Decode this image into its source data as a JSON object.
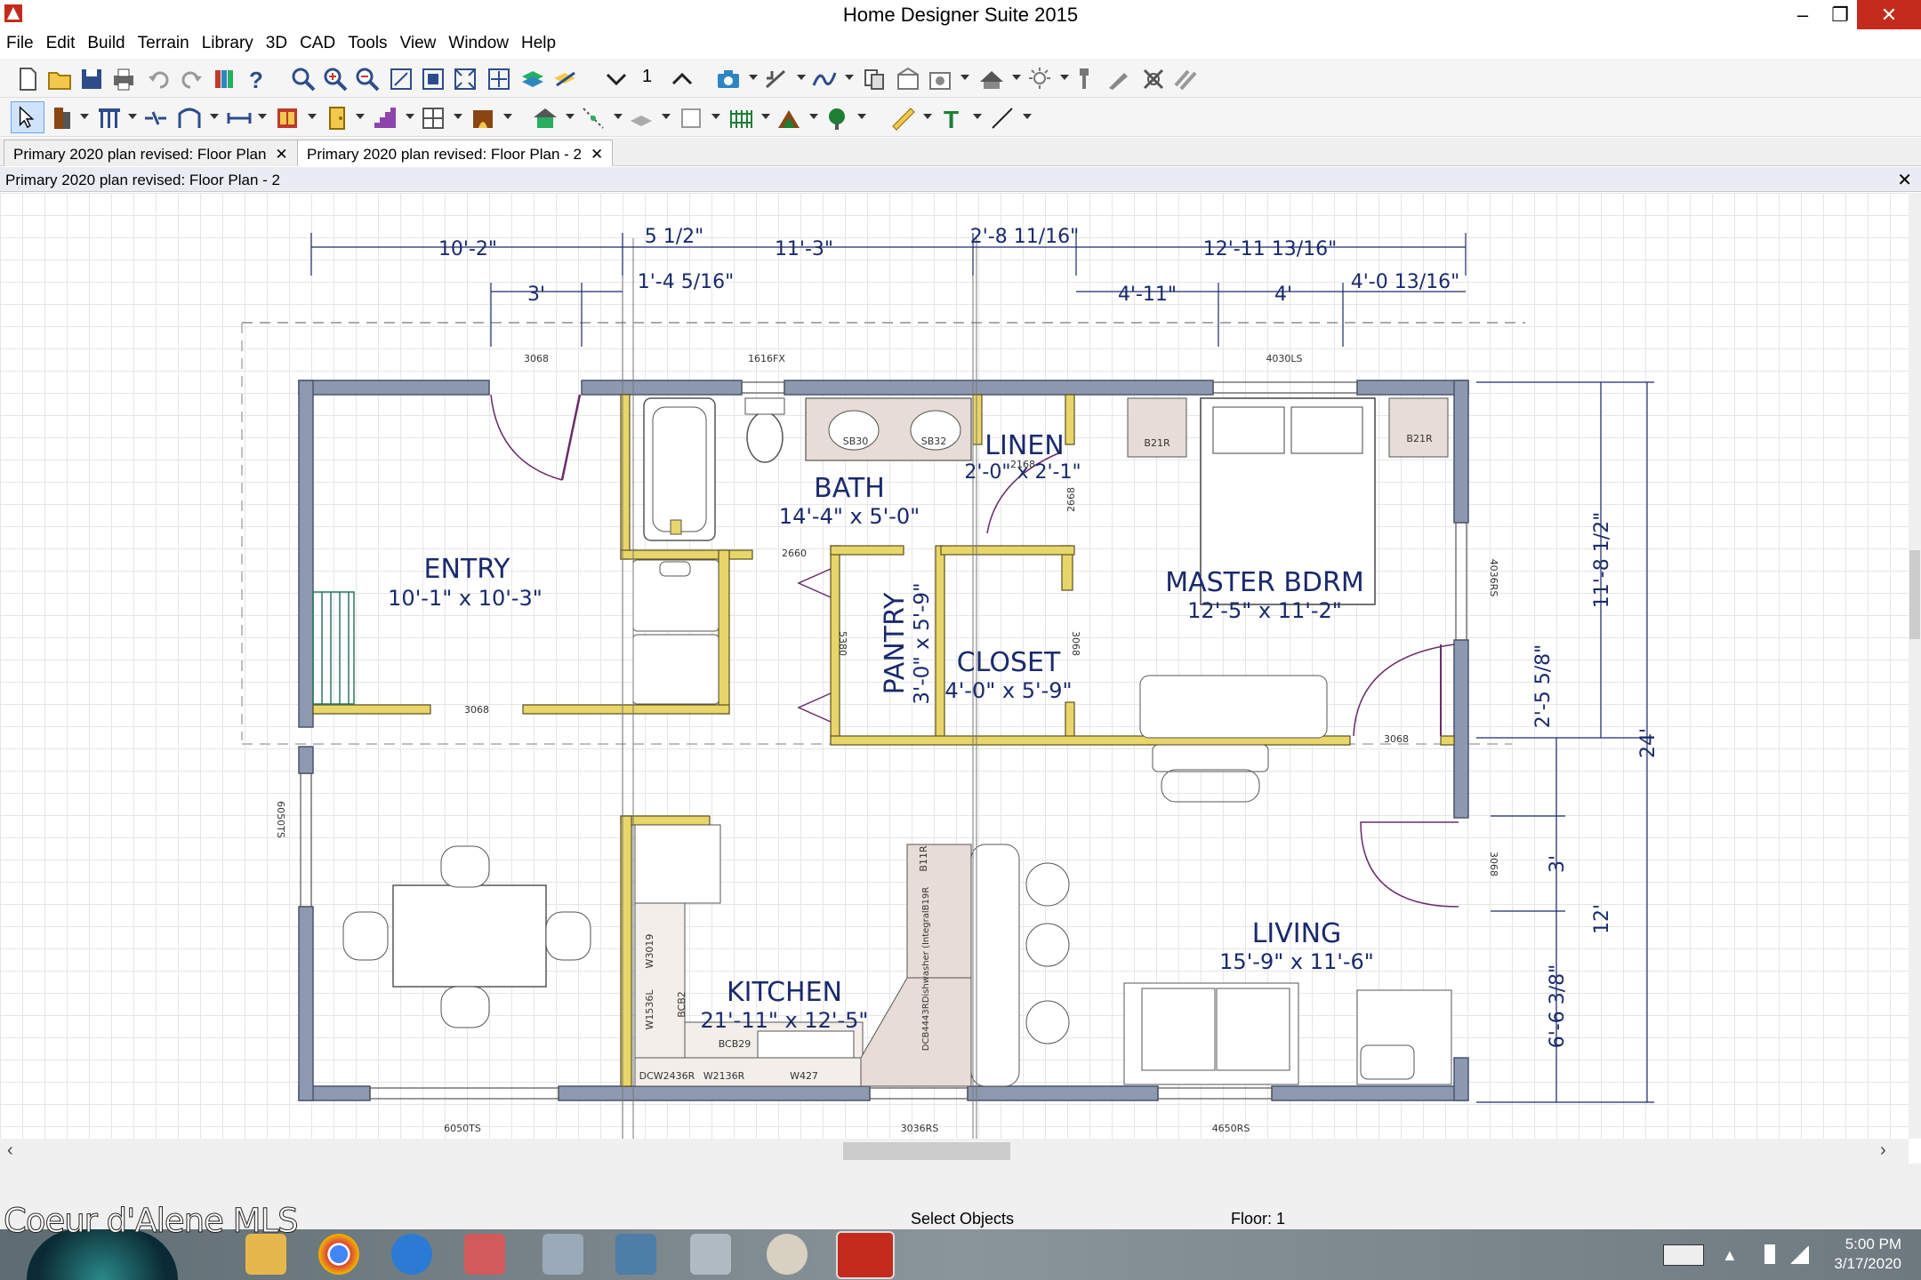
{
  "window": {
    "title": "Home Designer Suite 2015"
  },
  "menu": [
    "File",
    "Edit",
    "Build",
    "Terrain",
    "Library",
    "3D",
    "CAD",
    "Tools",
    "View",
    "Window",
    "Help"
  ],
  "toolbar": {
    "floor_level": "1"
  },
  "tabs": [
    {
      "label": "Primary 2020 plan revised: Floor Plan"
    },
    {
      "label": "Primary 2020 plan revised: Floor Plan - 2"
    }
  ],
  "doc_title": "Primary 2020 plan revised: Floor Plan - 2",
  "plan": {
    "rooms": [
      {
        "name": "ENTRY",
        "size": "10'-1\" x 10'-3\""
      },
      {
        "name": "BATH",
        "size": "14'-4\" x 5'-0\""
      },
      {
        "name": "LINEN",
        "size": "2'-0\" x 2'-1\""
      },
      {
        "name": "MASTER BDRM",
        "size": "12'-5\" x 11'-2\""
      },
      {
        "name": "PANTRY",
        "size": "3'-0\" x 5'-9\""
      },
      {
        "name": "CLOSET",
        "size": "4'-0\" x 5'-9\""
      },
      {
        "name": "KITCHEN",
        "size": "21'-11\" x 12'-5\""
      },
      {
        "name": "LIVING",
        "size": "15'-9\" x 11'-6\""
      }
    ],
    "top_dims": [
      "10'-2\"",
      "5 1/2\"",
      "11'-3\"",
      "2'-8 11/16\"",
      "12'-11 13/16\"",
      "3'",
      "1'-4 5/16\"",
      "4'-11\"",
      "4'",
      "4'-0 13/16\""
    ],
    "right_dims": [
      "11'-8 1/2\"",
      "2'-5 5/8\"",
      "24'",
      "3'",
      "12'",
      "6'-6 3/8\""
    ],
    "labels": [
      "3068",
      "1616FX",
      "4030LS",
      "SB30",
      "SB32",
      "B21R",
      "B21R",
      "2168",
      "2668",
      "2660",
      "4036RS",
      "5380",
      "3068",
      "3068",
      "3068",
      "3068",
      "6050TS",
      "6050TS",
      "3036RS",
      "4650RS",
      "B11R",
      "W3019",
      "W1536L",
      "BCB2",
      "BCB29",
      "DCW2436R",
      "W2136R",
      "W427",
      "DCB4443RDishwasher (IntegralB19R"
    ]
  },
  "status": {
    "message": "Select Objects",
    "floor": "Floor: 1"
  },
  "watermark": "Coeur d'Alene MLS",
  "tray": {
    "time": "5:00 PM",
    "date": "3/17/2020"
  },
  "colors": {
    "wall": "#8d99b0",
    "wall_dark": "#6b7690",
    "interior_wall": "#e8d66a",
    "dim": "#1a2a6c",
    "title_red": "#c42b1c"
  }
}
